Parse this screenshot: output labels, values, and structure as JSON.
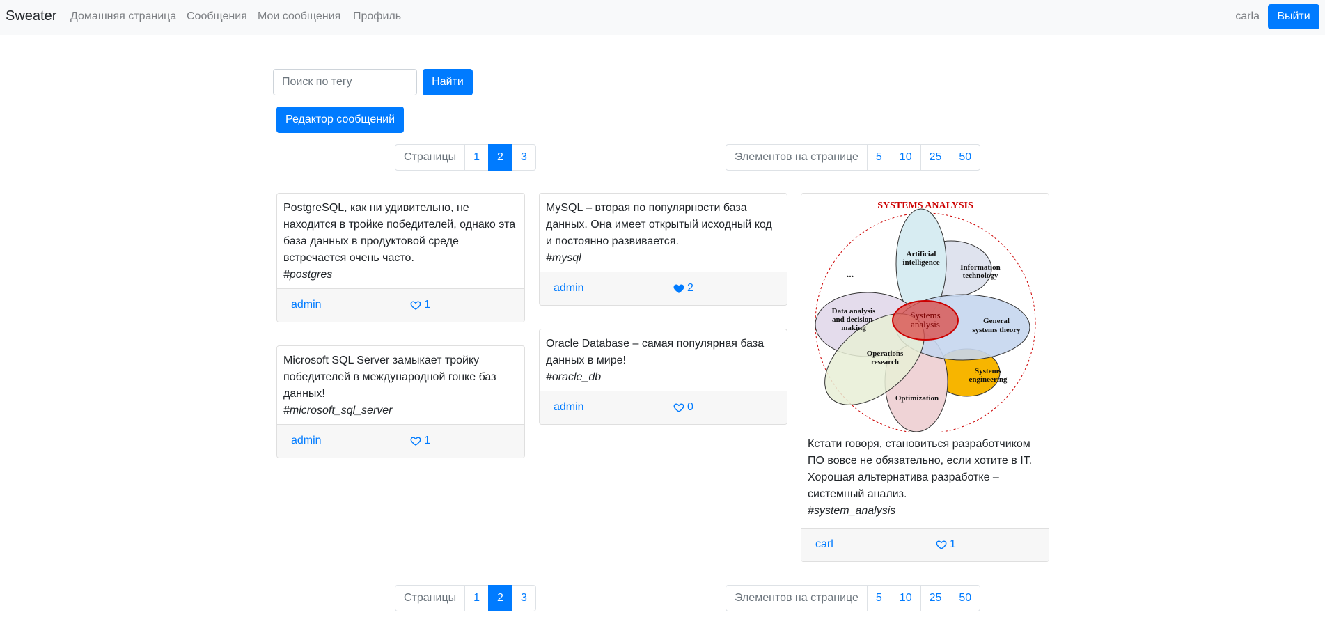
{
  "nav": {
    "brand": "Sweater",
    "links": [
      "Домашняя страница",
      "Сообщения",
      "Мои сообщения",
      "Профиль"
    ],
    "user": "carla",
    "logout": "Выйти"
  },
  "search": {
    "placeholder": "Поиск по тегу",
    "button": "Найти"
  },
  "editor_button": "Редактор сообщений",
  "pagination": {
    "pages_label": "Страницы",
    "pages": [
      "1",
      "2",
      "3"
    ],
    "current_page": "2",
    "size_label": "Элементов на странице",
    "sizes": [
      "5",
      "10",
      "25",
      "50"
    ]
  },
  "messages": [
    {
      "text": "PostgreSQL, как ни удивительно, не находится в тройке победителей, однако эта база данных в продуктовой среде встречается очень часто.",
      "tag": "#postgres",
      "author": "admin",
      "likes": "1",
      "liked": false
    },
    {
      "text": "Microsoft SQL Server замыкает тройку победителей в международной гонке баз данных!",
      "tag": "#microsoft_sql_server",
      "author": "admin",
      "likes": "1",
      "liked": false
    },
    {
      "text": "MySQL – вторая по популярности база данных. Она имеет открытый исходный код и постоянно развивается.",
      "tag": "#mysql",
      "author": "admin",
      "likes": "2",
      "liked": true
    },
    {
      "text": "Oracle Database – самая популярная база данных в мире!",
      "tag": "#oracle_db",
      "author": "admin",
      "likes": "0",
      "liked": false
    },
    {
      "text": "Кстати говоря, становиться разработчиком ПО вовсе не обязательно, если хотите в IT. Хорошая альтернатива разработке – системный анализ.",
      "tag": "#system_analysis",
      "author": "carl",
      "likes": "1",
      "liked": false
    }
  ],
  "diagram": {
    "title": "SYSTEMS ANALYSIS",
    "center": [
      "Systems",
      "analysis"
    ],
    "petals": {
      "ai": [
        "Artificial",
        "intelligence"
      ],
      "it": [
        "Information",
        "technology"
      ],
      "gst": [
        "General",
        "systems theory"
      ],
      "se": [
        "Systems",
        "engineering"
      ],
      "opt": [
        "Optimization"
      ],
      "or": [
        "Operations",
        "research"
      ],
      "da": [
        "Data analysis",
        "and decision-",
        "making"
      ],
      "more": "..."
    },
    "colors": {
      "title": "#cc0000",
      "ai": "#d7ecf2",
      "it": "#dfe3ee",
      "gst": "#c5d6ee",
      "se": "#f7b500",
      "opt": "#efd3d6",
      "or": "#e8efd6",
      "da": "#e4dcec",
      "center": "#d9534f"
    }
  }
}
